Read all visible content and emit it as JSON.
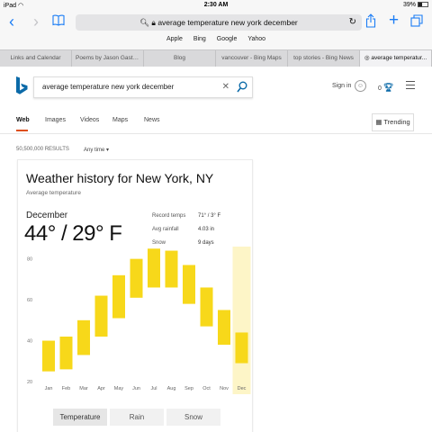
{
  "status": {
    "device": "iPad",
    "time": "2:30 AM",
    "battery": "39%"
  },
  "browser": {
    "url": "average temperature new york december",
    "bookmarks": [
      "Apple",
      "Bing",
      "Google",
      "Yahoo"
    ],
    "tabs": [
      {
        "label": "Links and Calendar",
        "active": false
      },
      {
        "label": "Poems by Jason Gastri...",
        "active": false
      },
      {
        "label": "Blog",
        "active": false
      },
      {
        "label": "vancouver - Bing Maps",
        "active": false
      },
      {
        "label": "top stories - Bing News",
        "active": false
      },
      {
        "label": "average temperatur...",
        "active": true
      }
    ]
  },
  "search": {
    "query": "average temperature new york december"
  },
  "header": {
    "signin": "Sign in",
    "rewards_count": "0"
  },
  "nav": {
    "tabs": [
      "Web",
      "Images",
      "Videos",
      "Maps",
      "News"
    ],
    "active": "Web",
    "trending": "Trending"
  },
  "results": {
    "count": "50,500,000 RESULTS",
    "filter": "Any time"
  },
  "weather": {
    "title": "Weather history for New York, NY",
    "subtitle": "Average temperature",
    "month": "December",
    "temp": "44° / 29° F",
    "stats": [
      {
        "label": "Record temps",
        "value": "71° / 3° F"
      },
      {
        "label": "Avg rainfall",
        "value": "4.03 in"
      },
      {
        "label": "Snow",
        "value": "9 days"
      }
    ],
    "tabs": [
      "Temperature",
      "Rain",
      "Snow"
    ],
    "active_tab": "Temperature"
  },
  "chart_data": {
    "type": "bar",
    "categories": [
      "Jan",
      "Feb",
      "Mar",
      "Apr",
      "May",
      "Jun",
      "Jul",
      "Aug",
      "Sep",
      "Oct",
      "Nov",
      "Dec"
    ],
    "series": [
      {
        "name": "low",
        "values": [
          25,
          26,
          33,
          42,
          51,
          61,
          66,
          66,
          58,
          47,
          38,
          29
        ]
      },
      {
        "name": "high",
        "values": [
          40,
          42,
          50,
          62,
          72,
          80,
          85,
          84,
          77,
          66,
          55,
          44
        ]
      }
    ],
    "yticks": [
      20,
      40,
      60,
      80
    ],
    "ylim": [
      20,
      86
    ],
    "highlight": "Dec",
    "bar_color": "#f7d81a",
    "highlight_color": "#fdf5c7"
  },
  "colors": {
    "accent": "#1a7cf5",
    "bing_blue": "#0b6aa8",
    "nav_underline": "#de4f1c"
  }
}
